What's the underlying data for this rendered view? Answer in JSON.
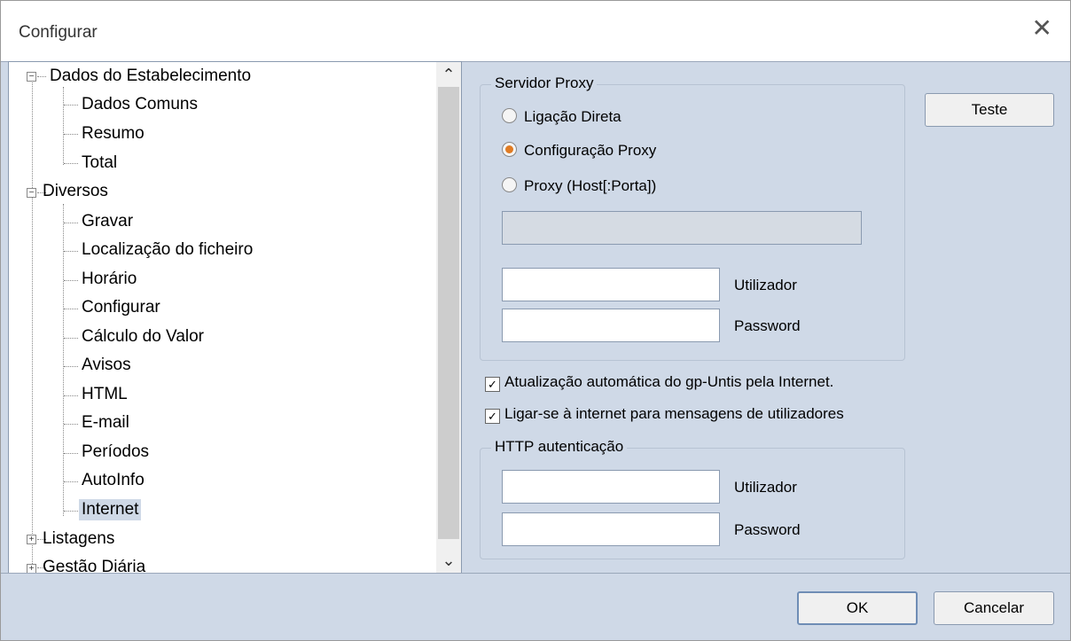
{
  "window": {
    "title": "Configurar"
  },
  "tree": {
    "groups": [
      {
        "label": "Dados do Estabelecimento",
        "expander": "−",
        "children": [
          "Dados Comuns",
          "Resumo",
          "Total"
        ]
      },
      {
        "label": "Diversos",
        "expander": "−",
        "children": [
          "Gravar",
          "Localização do ficheiro",
          "Horário",
          "Configurar",
          "Cálculo do Valor",
          "Avisos",
          "HTML",
          "E-mail",
          "Períodos",
          "AutoInfo",
          "Internet"
        ]
      },
      {
        "label": "Listagens",
        "expander": "+"
      },
      {
        "label": "Gestão Diária",
        "expander": "+"
      }
    ],
    "selected": "Internet"
  },
  "proxy": {
    "legend": "Servidor Proxy",
    "options": [
      "Ligação Direta",
      "Configuração Proxy",
      "Proxy (Host[:Porta])"
    ],
    "selected_index": 1,
    "user_label": "Utilizador",
    "password_label": "Password"
  },
  "checks": [
    {
      "label": "Atualização automática do gp-Untis pela Internet.",
      "checked": true
    },
    {
      "label": "Ligar-se à internet para mensagens de utilizadores",
      "checked": true
    }
  ],
  "http": {
    "legend": "HTTP autenticação",
    "user_label": "Utilizador",
    "password_label": "Password"
  },
  "buttons": {
    "test": "Teste",
    "ok": "OK",
    "cancel": "Cancelar"
  },
  "icons": {
    "close": "close-icon",
    "checkmark": "✓"
  }
}
